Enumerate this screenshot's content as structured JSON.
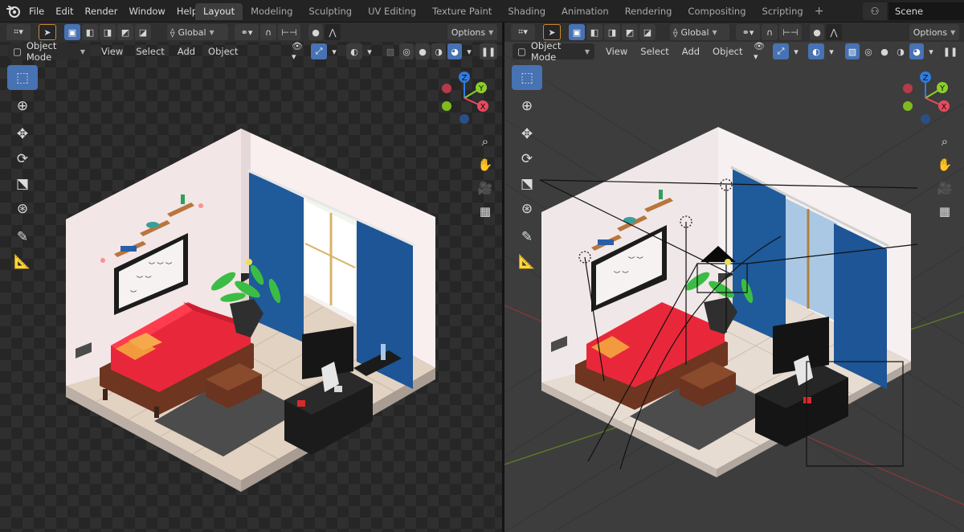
{
  "topbar": {
    "menu": [
      "File",
      "Edit",
      "Render",
      "Window",
      "Help"
    ],
    "workspaces": [
      "Layout",
      "Modeling",
      "Sculpting",
      "UV Editing",
      "Texture Paint",
      "Shading",
      "Animation",
      "Rendering",
      "Compositing",
      "Scripting"
    ],
    "active_workspace": "Layout",
    "add_workspace": "+",
    "scene_name": "Scene"
  },
  "viewport_left": {
    "transform_orientation": "Global",
    "options_label": "Options",
    "mode": "Object Mode",
    "menus": [
      "View",
      "Select",
      "Add",
      "Object"
    ],
    "shading": "rendered"
  },
  "viewport_right": {
    "transform_orientation": "Global",
    "options_label": "Options",
    "mode": "Object Mode",
    "menus": [
      "View",
      "Select",
      "Add",
      "Object"
    ],
    "shading": "solid-with-overlays"
  },
  "gizmo": {
    "x_label": "X",
    "y_label": "Y",
    "z_label": "Z",
    "x_color": "#e84a5f",
    "y_color": "#8ccf2a",
    "z_color": "#2f7de1"
  },
  "tools": [
    "select-box-icon",
    "cursor-icon",
    "move-icon",
    "rotate-icon",
    "scale-icon",
    "transform-icon",
    "annotate-icon",
    "measure-icon"
  ],
  "nav_tools": [
    "zoom-icon",
    "hand-icon",
    "camera-icon",
    "grid-icon"
  ],
  "colors": {
    "accent": "#4772b3",
    "sofa": "#e8283a",
    "curtain": "#1f5a9a",
    "wall": "#f4eaea"
  }
}
